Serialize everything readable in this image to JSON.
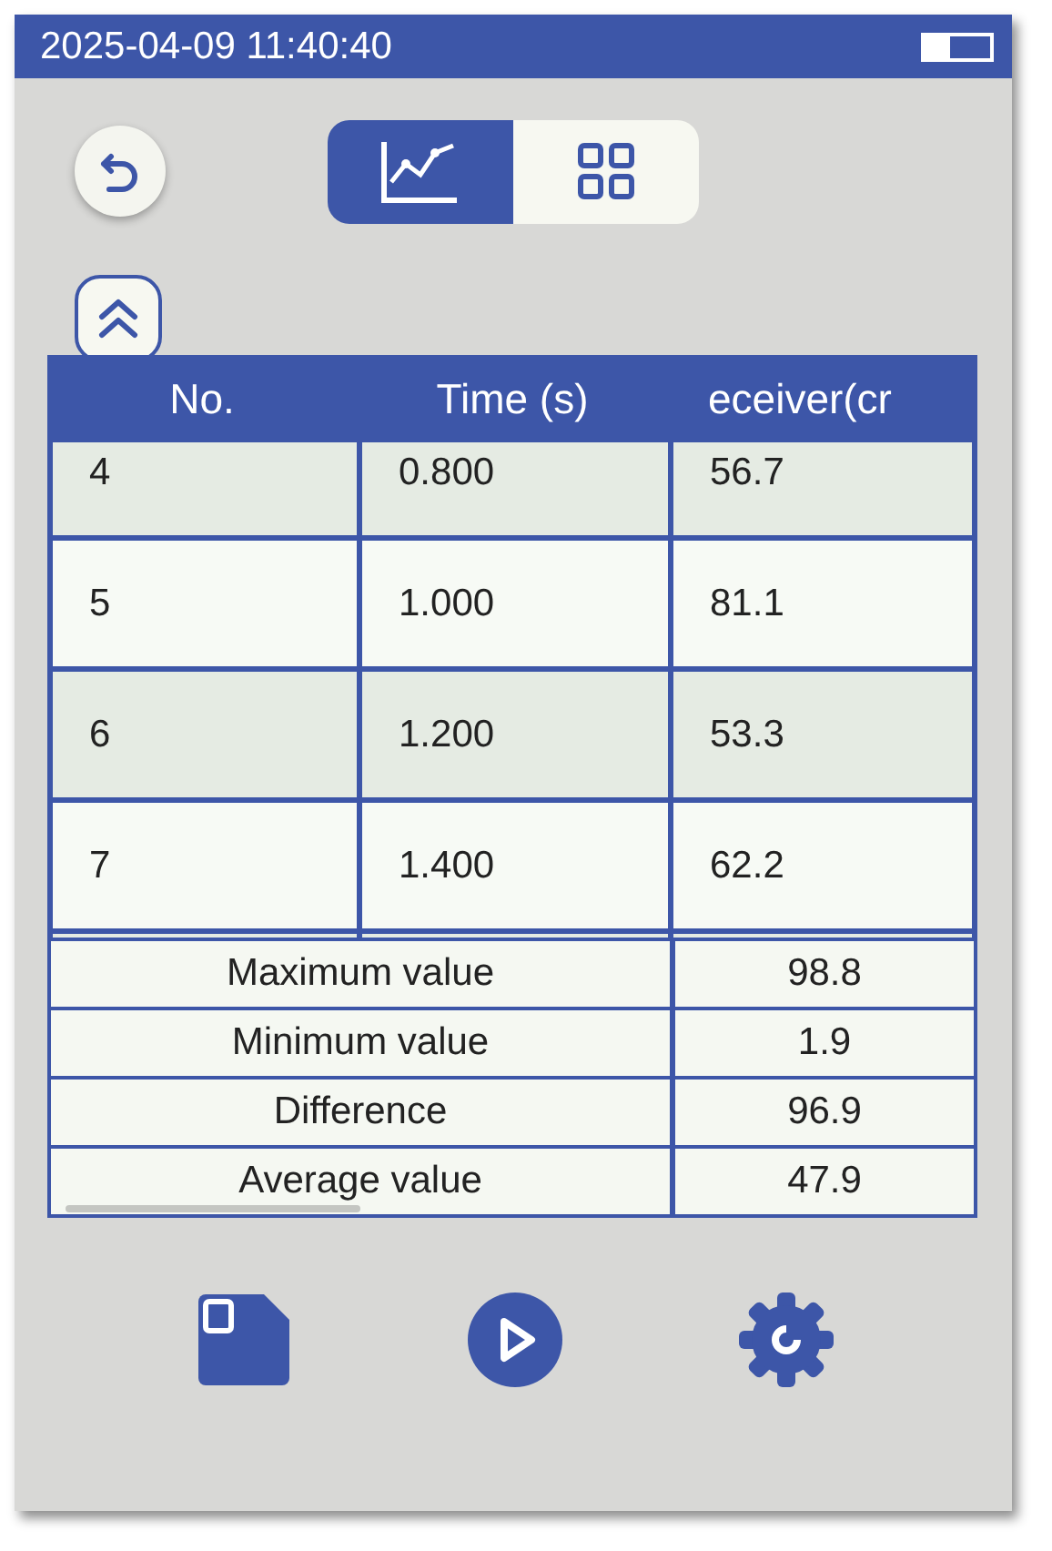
{
  "status_bar": {
    "datetime": "2025-04-09 11:40:40"
  },
  "view_tabs": [
    {
      "kind": "chart",
      "selected": true
    },
    {
      "kind": "grid",
      "selected": false
    }
  ],
  "table": {
    "columns": [
      "No.",
      "Time (s)",
      "eceiver(cr"
    ],
    "rows": [
      [
        "4",
        "0.800",
        "56.7"
      ],
      [
        "5",
        "1.000",
        "81.1"
      ],
      [
        "6",
        "1.200",
        "53.3"
      ],
      [
        "7",
        "1.400",
        "62.2"
      ]
    ],
    "summary": [
      {
        "label": "Maximum value",
        "value": "98.8"
      },
      {
        "label": "Minimum value",
        "value": "1.9"
      },
      {
        "label": "Difference",
        "value": "96.9"
      },
      {
        "label": "Average value",
        "value": "47.9"
      }
    ]
  },
  "bottom_buttons": [
    {
      "kind": "save"
    },
    {
      "kind": "play"
    },
    {
      "kind": "settings"
    }
  ]
}
